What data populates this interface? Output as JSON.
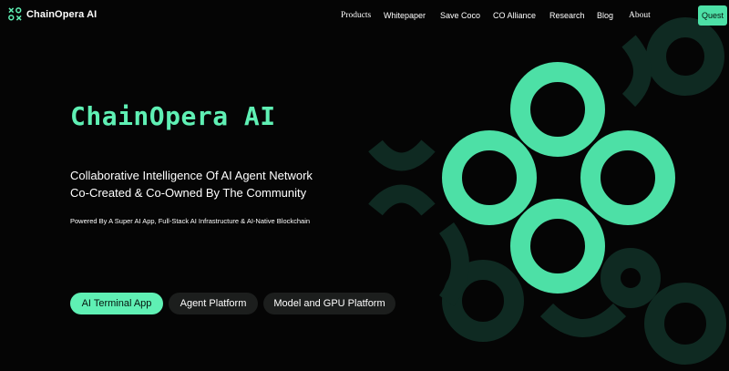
{
  "nav": {
    "brand": "ChainOpera AI",
    "logo_icon": "chainopera-logo-icon",
    "items": [
      {
        "label": "Products"
      },
      {
        "label": "Whitepaper"
      },
      {
        "label": "Save Coco"
      },
      {
        "label": "CO Alliance"
      },
      {
        "label": "Research"
      },
      {
        "label": "Blog"
      },
      {
        "label": "About"
      }
    ],
    "quest_label": "Quest"
  },
  "hero": {
    "title": "ChainOpera AI",
    "tagline_line1": "Collaborative Intelligence Of AI Agent Network",
    "tagline_line2": "Co-Created & Co-Owned By The Community",
    "powered_by": "Powered By A Super AI App, Full-Stack AI Infrastructure & AI-Native Blockchain",
    "buttons": [
      {
        "label": "AI Terminal App"
      },
      {
        "label": "Agent Platform"
      },
      {
        "label": "Model and GPU Platform"
      }
    ]
  },
  "colors": {
    "accent": "#5ff0b4",
    "background": "#050505",
    "button_dark": "#1c1e1d",
    "ring_dark": "#0f2a22"
  },
  "art": {
    "name": "four-ring-logo-graphic"
  }
}
